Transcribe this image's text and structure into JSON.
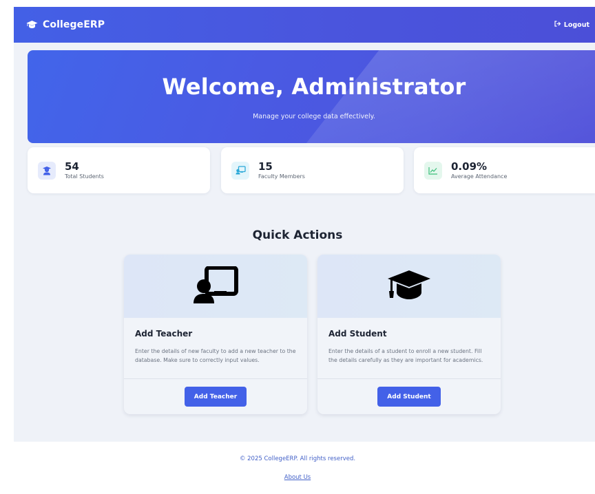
{
  "navbar": {
    "brand": "CollegeERP",
    "brand_icon": "graduation-cap-icon",
    "logout_label": "Logout",
    "logout_icon": "logout-icon"
  },
  "hero": {
    "title": "Welcome, Administrator",
    "subtitle": "Manage your college data effectively."
  },
  "stats": [
    {
      "value": "54",
      "label": "Total Students",
      "icon": "user-graduate-icon",
      "color": "#4361e8",
      "bg": "#e6ebfc"
    },
    {
      "value": "15",
      "label": "Faculty Members",
      "icon": "chalkboard-teacher-icon",
      "color": "#2aa8d8",
      "bg": "#e3f5fb"
    },
    {
      "value": "0.09%",
      "label": "Average Attendance",
      "icon": "chart-line-icon",
      "color": "#3bbf7a",
      "bg": "#e4f7ed"
    }
  ],
  "quick_actions": {
    "title": "Quick Actions",
    "cards": [
      {
        "title": "Add Teacher",
        "description": "Enter the details of new faculty to add a new teacher to the database. Make sure to correctly input values.",
        "button": "Add Teacher",
        "icon": "chalkboard-teacher-icon"
      },
      {
        "title": "Add Student",
        "description": "Enter the details of a student to enroll a new student. Fill the details carefully as they are important for academics.",
        "button": "Add Student",
        "icon": "graduation-cap-icon"
      }
    ]
  },
  "footer": {
    "copyright": "© 2025 CollegeERP. All rights reserved.",
    "about_link": "About Us"
  },
  "colors": {
    "primary": "#4361e8",
    "background": "#eff2f8"
  }
}
